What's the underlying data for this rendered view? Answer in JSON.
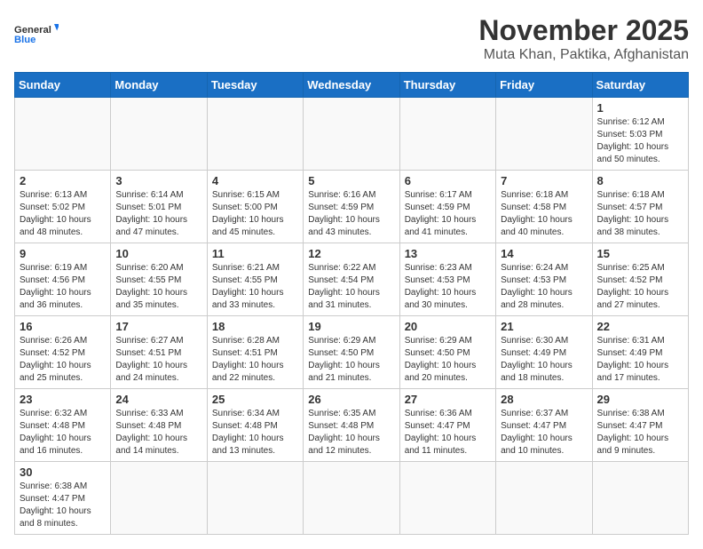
{
  "logo": {
    "line1": "General",
    "line2": "Blue"
  },
  "title": "November 2025",
  "location": "Muta Khan, Paktika, Afghanistan",
  "days": [
    "Sunday",
    "Monday",
    "Tuesday",
    "Wednesday",
    "Thursday",
    "Friday",
    "Saturday"
  ],
  "weeks": [
    [
      {
        "date": "",
        "info": ""
      },
      {
        "date": "",
        "info": ""
      },
      {
        "date": "",
        "info": ""
      },
      {
        "date": "",
        "info": ""
      },
      {
        "date": "",
        "info": ""
      },
      {
        "date": "",
        "info": ""
      },
      {
        "date": "1",
        "info": "Sunrise: 6:12 AM\nSunset: 5:03 PM\nDaylight: 10 hours\nand 50 minutes."
      }
    ],
    [
      {
        "date": "2",
        "info": "Sunrise: 6:13 AM\nSunset: 5:02 PM\nDaylight: 10 hours\nand 48 minutes."
      },
      {
        "date": "3",
        "info": "Sunrise: 6:14 AM\nSunset: 5:01 PM\nDaylight: 10 hours\nand 47 minutes."
      },
      {
        "date": "4",
        "info": "Sunrise: 6:15 AM\nSunset: 5:00 PM\nDaylight: 10 hours\nand 45 minutes."
      },
      {
        "date": "5",
        "info": "Sunrise: 6:16 AM\nSunset: 4:59 PM\nDaylight: 10 hours\nand 43 minutes."
      },
      {
        "date": "6",
        "info": "Sunrise: 6:17 AM\nSunset: 4:59 PM\nDaylight: 10 hours\nand 41 minutes."
      },
      {
        "date": "7",
        "info": "Sunrise: 6:18 AM\nSunset: 4:58 PM\nDaylight: 10 hours\nand 40 minutes."
      },
      {
        "date": "8",
        "info": "Sunrise: 6:18 AM\nSunset: 4:57 PM\nDaylight: 10 hours\nand 38 minutes."
      }
    ],
    [
      {
        "date": "9",
        "info": "Sunrise: 6:19 AM\nSunset: 4:56 PM\nDaylight: 10 hours\nand 36 minutes."
      },
      {
        "date": "10",
        "info": "Sunrise: 6:20 AM\nSunset: 4:55 PM\nDaylight: 10 hours\nand 35 minutes."
      },
      {
        "date": "11",
        "info": "Sunrise: 6:21 AM\nSunset: 4:55 PM\nDaylight: 10 hours\nand 33 minutes."
      },
      {
        "date": "12",
        "info": "Sunrise: 6:22 AM\nSunset: 4:54 PM\nDaylight: 10 hours\nand 31 minutes."
      },
      {
        "date": "13",
        "info": "Sunrise: 6:23 AM\nSunset: 4:53 PM\nDaylight: 10 hours\nand 30 minutes."
      },
      {
        "date": "14",
        "info": "Sunrise: 6:24 AM\nSunset: 4:53 PM\nDaylight: 10 hours\nand 28 minutes."
      },
      {
        "date": "15",
        "info": "Sunrise: 6:25 AM\nSunset: 4:52 PM\nDaylight: 10 hours\nand 27 minutes."
      }
    ],
    [
      {
        "date": "16",
        "info": "Sunrise: 6:26 AM\nSunset: 4:52 PM\nDaylight: 10 hours\nand 25 minutes."
      },
      {
        "date": "17",
        "info": "Sunrise: 6:27 AM\nSunset: 4:51 PM\nDaylight: 10 hours\nand 24 minutes."
      },
      {
        "date": "18",
        "info": "Sunrise: 6:28 AM\nSunset: 4:51 PM\nDaylight: 10 hours\nand 22 minutes."
      },
      {
        "date": "19",
        "info": "Sunrise: 6:29 AM\nSunset: 4:50 PM\nDaylight: 10 hours\nand 21 minutes."
      },
      {
        "date": "20",
        "info": "Sunrise: 6:29 AM\nSunset: 4:50 PM\nDaylight: 10 hours\nand 20 minutes."
      },
      {
        "date": "21",
        "info": "Sunrise: 6:30 AM\nSunset: 4:49 PM\nDaylight: 10 hours\nand 18 minutes."
      },
      {
        "date": "22",
        "info": "Sunrise: 6:31 AM\nSunset: 4:49 PM\nDaylight: 10 hours\nand 17 minutes."
      }
    ],
    [
      {
        "date": "23",
        "info": "Sunrise: 6:32 AM\nSunset: 4:48 PM\nDaylight: 10 hours\nand 16 minutes."
      },
      {
        "date": "24",
        "info": "Sunrise: 6:33 AM\nSunset: 4:48 PM\nDaylight: 10 hours\nand 14 minutes."
      },
      {
        "date": "25",
        "info": "Sunrise: 6:34 AM\nSunset: 4:48 PM\nDaylight: 10 hours\nand 13 minutes."
      },
      {
        "date": "26",
        "info": "Sunrise: 6:35 AM\nSunset: 4:48 PM\nDaylight: 10 hours\nand 12 minutes."
      },
      {
        "date": "27",
        "info": "Sunrise: 6:36 AM\nSunset: 4:47 PM\nDaylight: 10 hours\nand 11 minutes."
      },
      {
        "date": "28",
        "info": "Sunrise: 6:37 AM\nSunset: 4:47 PM\nDaylight: 10 hours\nand 10 minutes."
      },
      {
        "date": "29",
        "info": "Sunrise: 6:38 AM\nSunset: 4:47 PM\nDaylight: 10 hours\nand 9 minutes."
      }
    ],
    [
      {
        "date": "30",
        "info": "Sunrise: 6:38 AM\nSunset: 4:47 PM\nDaylight: 10 hours\nand 8 minutes."
      },
      {
        "date": "",
        "info": ""
      },
      {
        "date": "",
        "info": ""
      },
      {
        "date": "",
        "info": ""
      },
      {
        "date": "",
        "info": ""
      },
      {
        "date": "",
        "info": ""
      },
      {
        "date": "",
        "info": ""
      }
    ]
  ]
}
